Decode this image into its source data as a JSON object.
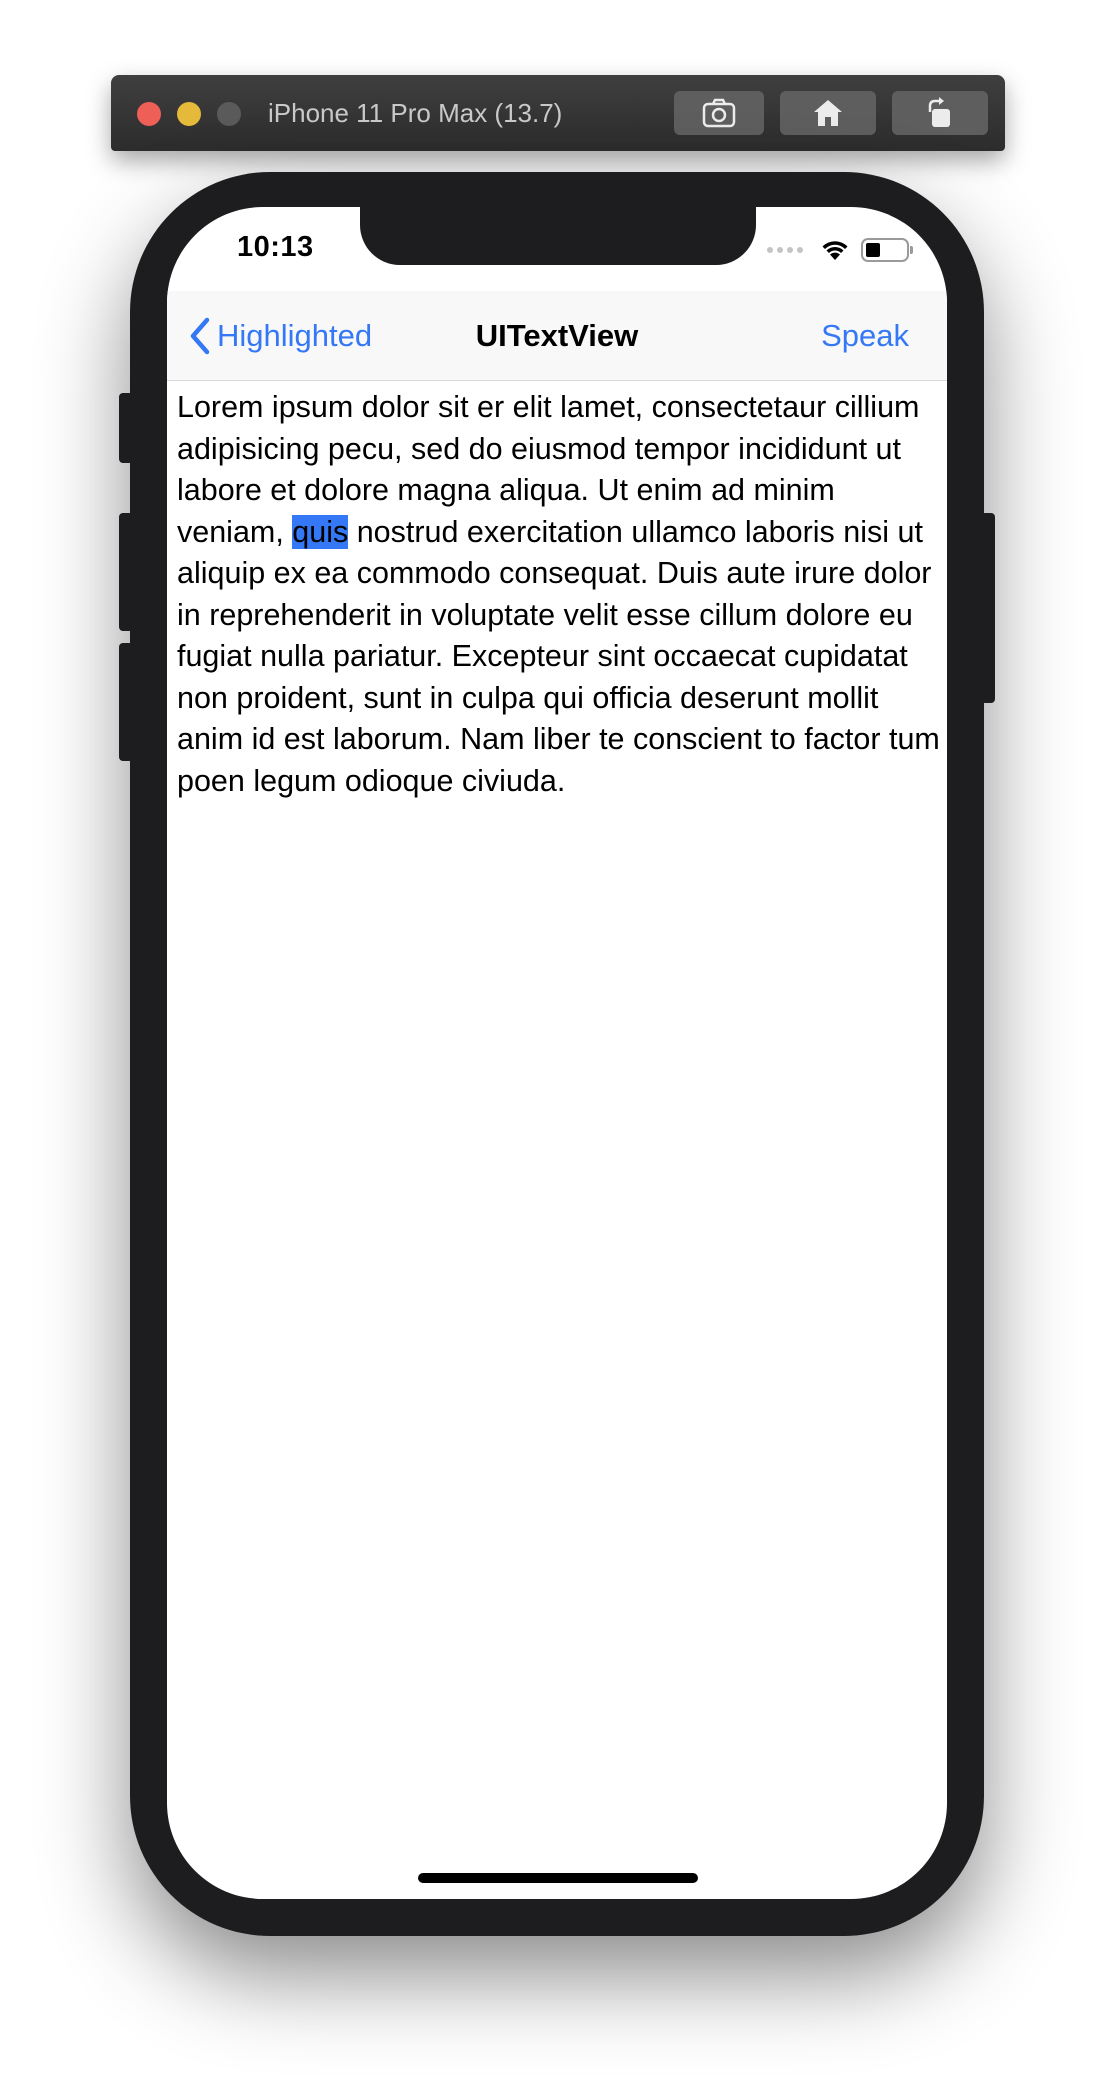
{
  "simulator": {
    "title": "iPhone 11 Pro Max (13.7)",
    "buttons": [
      "screenshot-icon",
      "home-icon",
      "rotate-icon"
    ]
  },
  "status_bar": {
    "time": "10:13",
    "icons": [
      "cellular-signal-icon",
      "wifi-icon",
      "battery-icon"
    ]
  },
  "nav": {
    "back_label": "Highlighted",
    "title": "UITextView",
    "right_label": "Speak"
  },
  "text_view": {
    "before": "Lorem ipsum dolor sit er elit lamet, consectetaur cillium adipisicing pecu, sed do eiusmod tempor incididunt ut labore et dolore magna aliqua. Ut enim ad minim veniam, ",
    "highlighted": "quis",
    "after": " nostrud exercitation ullamco laboris nisi ut aliquip ex ea commodo consequat. Duis aute irure dolor in reprehenderit in voluptate velit esse cillum dolore eu fugiat nulla pariatur. Excepteur sint occaecat cupidatat non proident, sunt in culpa qui officia deserunt mollit anim id est laborum. Nam liber te conscient to factor tum poen legum odioque civiuda."
  },
  "colors": {
    "tint": "#3478f6",
    "highlight": "#3478f6",
    "device_frame": "#1d1d1f"
  }
}
